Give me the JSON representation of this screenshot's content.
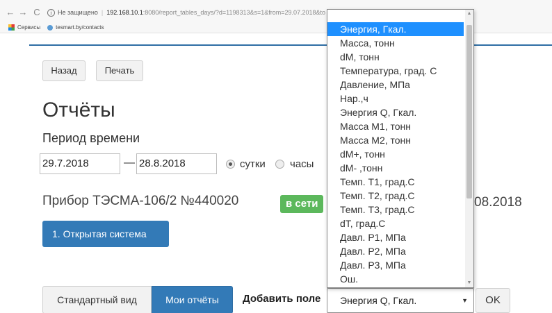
{
  "browser": {
    "back_glyph": "←",
    "forward_glyph": "→",
    "reload_glyph": "C",
    "security_label": "Не защищено",
    "host": "192.168.10.1",
    "url_rest": ":8080/report_tables_days/?d=1198313&s=1&from=29.07.2018&to",
    "bookmarks": {
      "apps_label": "Сервисы",
      "site_label": "tesmart.by/contacts"
    }
  },
  "toolbar": {
    "back_label": "Назад",
    "print_label": "Печать"
  },
  "page": {
    "title": "Отчёты",
    "period_label": "Период времени"
  },
  "period": {
    "from": "29.7.2018",
    "dash": "—",
    "to": "28.8.2018",
    "days_label": "сутки",
    "hours_label": "часы",
    "selected": "сутки"
  },
  "device": {
    "name": "Прибор ТЭСМА-106/2 №440020",
    "status": "в сети",
    "date_tail": "08.2018",
    "system_button": "1. Открытая система",
    "status_color": "#5cb85c"
  },
  "tabs": {
    "standard": "Стандартный вид",
    "mine": "Мои отчёты"
  },
  "add_field": {
    "label": "Добавить поле",
    "selected_value": "Энергия Q, Гкал.",
    "ok_label": "OK",
    "highlighted": "Энергия, Гкал.",
    "options": [
      "Энергия, Гкал.",
      "Масса, тонн",
      "dM, тонн",
      "Температура, град. С",
      "Давление, МПа",
      "Нар.,ч",
      "Энергия Q, Гкал.",
      "Масса М1, тонн",
      "Масса М2, тонн",
      "dM+, тонн",
      "dM- ,тонн",
      "Темп. Т1, град.С",
      "Темп. Т2, град.С",
      "Темп. Т3, град.С",
      "dT, град.С",
      "Давл. Р1, МПа",
      "Давл. Р2, МПа",
      "Давл. Р3, МПа",
      "Ош."
    ]
  },
  "colors": {
    "primary": "#337ab7",
    "highlight": "#1e90ff",
    "success": "#5cb85c"
  }
}
